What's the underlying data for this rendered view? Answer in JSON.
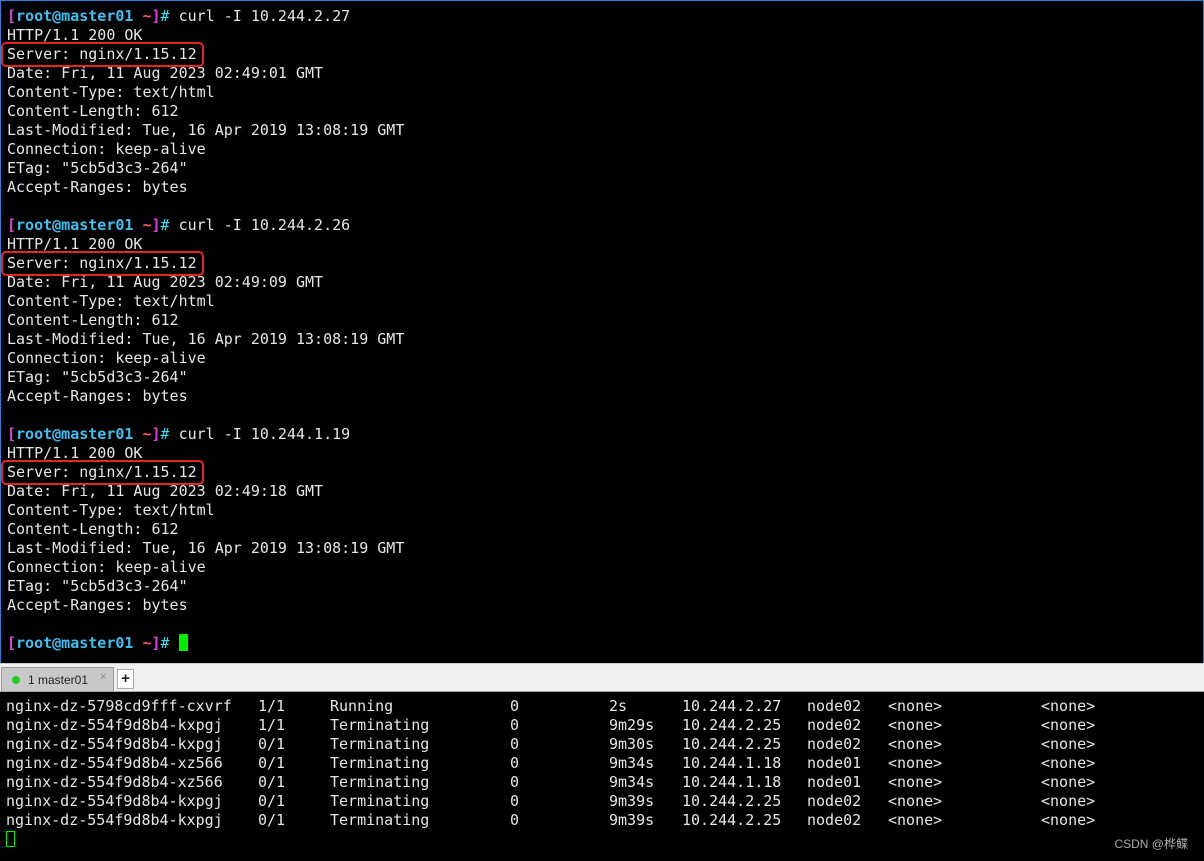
{
  "prompt": {
    "open": "[",
    "user": "root@master01",
    "path": "~",
    "close": "]",
    "hash": "# "
  },
  "blocks": [
    {
      "command": "curl -I 10.244.2.27",
      "lines": [
        "HTTP/1.1 200 OK",
        "Server: nginx/1.15.12",
        "Date: Fri, 11 Aug 2023 02:49:01 GMT",
        "Content-Type: text/html",
        "Content-Length: 612",
        "Last-Modified: Tue, 16 Apr 2019 13:08:19 GMT",
        "Connection: keep-alive",
        "ETag: \"5cb5d3c3-264\"",
        "Accept-Ranges: bytes"
      ]
    },
    {
      "command": "curl -I 10.244.2.26",
      "lines": [
        "HTTP/1.1 200 OK",
        "Server: nginx/1.15.12",
        "Date: Fri, 11 Aug 2023 02:49:09 GMT",
        "Content-Type: text/html",
        "Content-Length: 612",
        "Last-Modified: Tue, 16 Apr 2019 13:08:19 GMT",
        "Connection: keep-alive",
        "ETag: \"5cb5d3c3-264\"",
        "Accept-Ranges: bytes"
      ]
    },
    {
      "command": "curl -I 10.244.1.19",
      "lines": [
        "HTTP/1.1 200 OK",
        "Server: nginx/1.15.12",
        "Date: Fri, 11 Aug 2023 02:49:18 GMT",
        "Content-Type: text/html",
        "Content-Length: 612",
        "Last-Modified: Tue, 16 Apr 2019 13:08:19 GMT",
        "Connection: keep-alive",
        "ETag: \"5cb5d3c3-264\"",
        "Accept-Ranges: bytes"
      ]
    }
  ],
  "highlight_color": "#e8241f",
  "tab": {
    "label": "1 master01",
    "close": "×",
    "add": "+",
    "status_color": "#22cc22"
  },
  "pods": [
    [
      "nginx-dz-5798cd9fff-cxvrf",
      "1/1",
      "Running",
      "0",
      "2s",
      "10.244.2.27",
      "node02",
      "<none>",
      "<none>"
    ],
    [
      "nginx-dz-554f9d8b4-kxpgj",
      "1/1",
      "Terminating",
      "0",
      "9m29s",
      "10.244.2.25",
      "node02",
      "<none>",
      "<none>"
    ],
    [
      "nginx-dz-554f9d8b4-kxpgj",
      "0/1",
      "Terminating",
      "0",
      "9m30s",
      "10.244.2.25",
      "node02",
      "<none>",
      "<none>"
    ],
    [
      "nginx-dz-554f9d8b4-xz566",
      "0/1",
      "Terminating",
      "0",
      "9m34s",
      "10.244.1.18",
      "node01",
      "<none>",
      "<none>"
    ],
    [
      "nginx-dz-554f9d8b4-xz566",
      "0/1",
      "Terminating",
      "0",
      "9m34s",
      "10.244.1.18",
      "node01",
      "<none>",
      "<none>"
    ],
    [
      "nginx-dz-554f9d8b4-kxpgj",
      "0/1",
      "Terminating",
      "0",
      "9m39s",
      "10.244.2.25",
      "node02",
      "<none>",
      "<none>"
    ],
    [
      "nginx-dz-554f9d8b4-kxpgj",
      "0/1",
      "Terminating",
      "0",
      "9m39s",
      "10.244.2.25",
      "node02",
      "<none>",
      "<none>"
    ]
  ],
  "watermark": "CSDN @桦鲽"
}
